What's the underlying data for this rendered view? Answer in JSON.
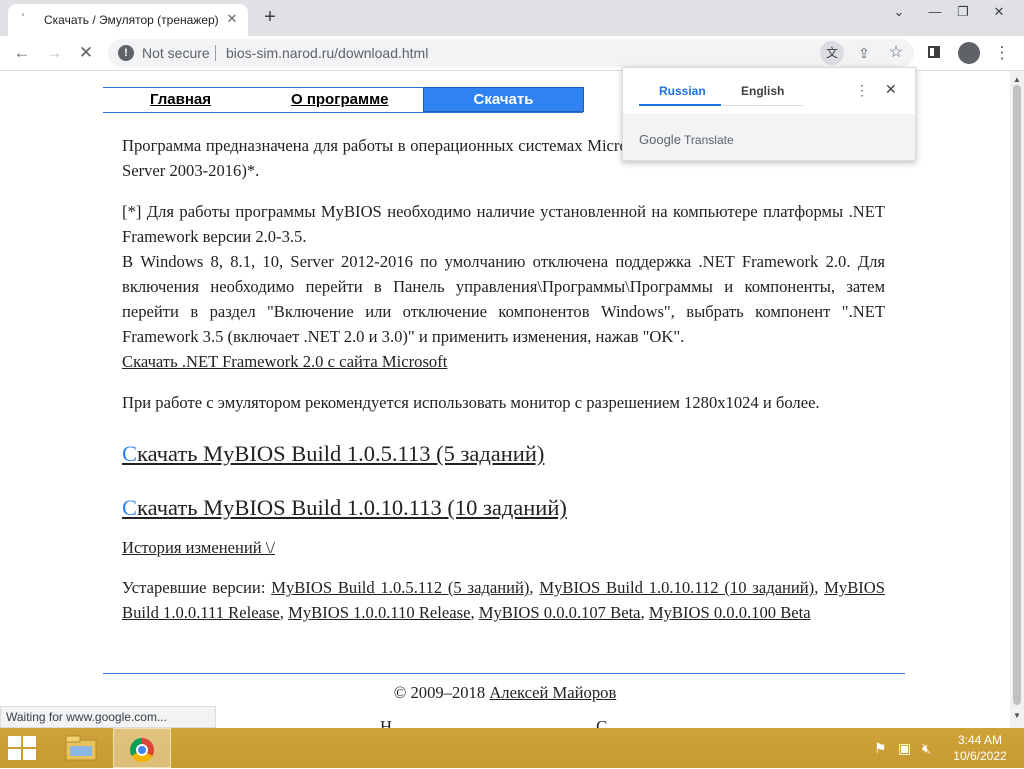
{
  "browser": {
    "tab_title": "Скачать / Эмулятор (тренажер)",
    "address_warning": "Not secure",
    "url": "bios-sim.narod.ru/download.html",
    "status_text": "Waiting for www.google.com..."
  },
  "site_nav": {
    "home": "Главная",
    "about": "О программе",
    "download": "Скачать"
  },
  "content": {
    "intro": "Программа предназначена для работы в операционных системах Microsoft Windows (XP, Vista, 7, 8, 8.1, 10, Server 2003-2016)*.",
    "note_p1": "[*] Для работы программы MyBIOS необходимо наличие установленной на компьютере платформы .NET Framework версии 2.0-3.5.",
    "note_p2": "В Windows 8, 8.1, 10, Server 2012-2016 по умолчанию отключена поддержка .NET Framework 2.0. Для включения необходимо перейти в Панель управления\\Программы\\Программы и компоненты, затем перейти в раздел \"Включение или отключение компонентов Windows\", выбрать компонент \".NET Framework 3.5 (включает .NET 2.0 и 3.0)\" и применить изменения, нажав \"OK\".",
    "net_link": "Скачать .NET Framework 2.0 с сайта Microsoft",
    "monitor_note": "При работе с эмулятором рекомендуется использовать монитор с разрешением 1280x1024 и более.",
    "download1_first": "С",
    "download1_rest": "качать MyBIOS Build 1.0.5.113 (5 заданий)",
    "download2_first": "С",
    "download2_rest": "качать MyBIOS Build 1.0.10.113 (10 заданий)",
    "history_link": "История изменений \\/",
    "old_label": "Устаревшие версии:",
    "old1": "MyBIOS Build 1.0.5.112 (5 заданий)",
    "old2": "MyBIOS Build 1.0.10.112 (10 заданий)",
    "old3": "MyBIOS Build 1.0.0.111 Release",
    "old4": "MyBIOS 1.0.0.110 Release",
    "old5": "MyBIOS 0.0.0.107 Beta",
    "old6": "MyBIOS 0.0.0.100 Beta",
    "copyright": "© 2009–2018",
    "author_link": "Алексей Майоров",
    "footer_partial_1": "Н",
    "footer_partial_2": "С"
  },
  "translate_popup": {
    "lang_from": "Russian",
    "lang_to": "English",
    "brand_google": "Google",
    "brand_translate": "Translate"
  },
  "taskbar": {
    "time": "3:44 AM",
    "date": "10/6/2022"
  },
  "colors": {
    "accent": "#2f82f0",
    "taskbar": "#c9a033"
  }
}
